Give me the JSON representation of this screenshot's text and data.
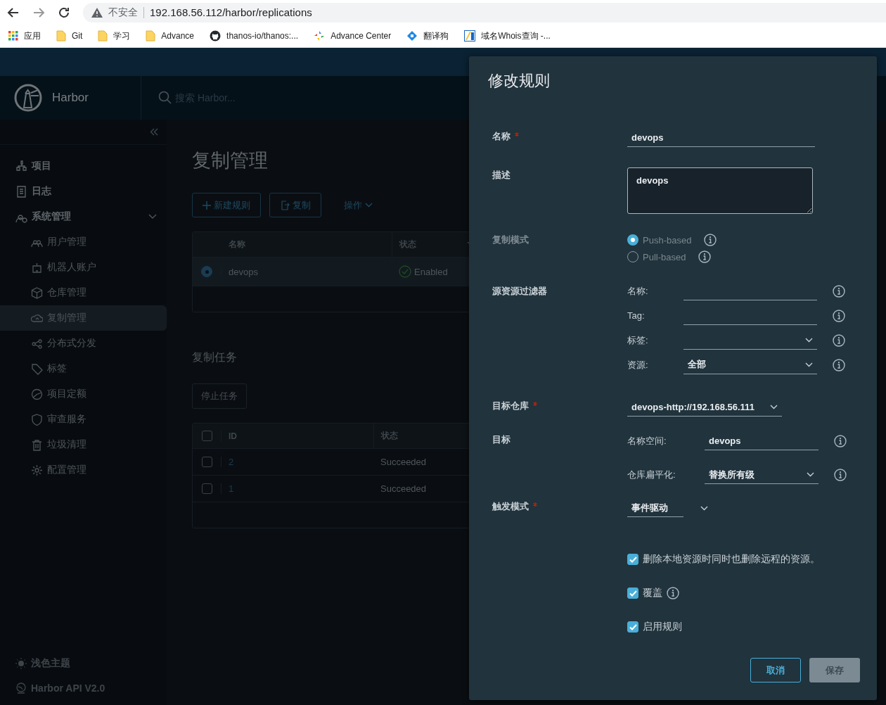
{
  "browser": {
    "security": "不安全",
    "url": "192.168.56.112/harbor/replications",
    "bookmarks": [
      {
        "label": "应用",
        "kind": "apps"
      },
      {
        "label": "Git",
        "kind": "folder"
      },
      {
        "label": "学习",
        "kind": "folder"
      },
      {
        "label": "Advance",
        "kind": "folder"
      },
      {
        "label": "thanos-io/thanos:...",
        "kind": "github"
      },
      {
        "label": "Advance Center",
        "kind": "pinwheel"
      },
      {
        "label": "翻译狗",
        "kind": "diamond"
      },
      {
        "label": "域名Whois查询 -...",
        "kind": "square"
      }
    ]
  },
  "header": {
    "brand": "Harbor",
    "search": {
      "placeholder": "搜索 Harbor..."
    }
  },
  "sidebar": {
    "items": [
      {
        "label": "项目",
        "selected": false
      },
      {
        "label": "日志",
        "selected": false
      },
      {
        "label": "系统管理",
        "selected": false,
        "expanded": true,
        "children": [
          {
            "label": "用户管理",
            "selected": false
          },
          {
            "label": "机器人账户",
            "selected": false
          },
          {
            "label": "仓库管理",
            "selected": false
          },
          {
            "label": "复制管理",
            "selected": true
          },
          {
            "label": "分布式分发",
            "selected": false
          },
          {
            "label": "标签",
            "selected": false
          },
          {
            "label": "项目定额",
            "selected": false
          },
          {
            "label": "审查服务",
            "selected": false
          },
          {
            "label": "垃圾清理",
            "selected": false
          },
          {
            "label": "配置管理",
            "selected": false
          }
        ]
      }
    ],
    "footer": [
      {
        "label": "浅色主题"
      },
      {
        "label": "Harbor API V2.0"
      }
    ]
  },
  "main": {
    "title": "复制管理",
    "toolbar": [
      {
        "label": "新建规则"
      },
      {
        "label": "复制"
      },
      {
        "label": "操作"
      }
    ],
    "rules_table": {
      "columns": [
        "名称",
        "状态"
      ],
      "rows": [
        {
          "selected": true,
          "name": "devops",
          "status": "Enabled"
        }
      ]
    },
    "tasks_title": "复制任务",
    "stop_button": {
      "label": "停止任务",
      "disabled": true
    },
    "tasks_table": {
      "select_all_checked": false,
      "columns": [
        "ID",
        "状态"
      ],
      "rows": [
        {
          "checked": false,
          "id": "2",
          "status": "Succeeded"
        },
        {
          "checked": false,
          "id": "1",
          "status": "Succeeded"
        }
      ]
    }
  },
  "dialog": {
    "title": "修改规则",
    "name": {
      "label": "名称",
      "required": true,
      "value": "devops"
    },
    "description": {
      "label": "描述",
      "value": "devops"
    },
    "mode": {
      "label": "复制模式",
      "disabled": true,
      "options": [
        {
          "label": "Push-based",
          "selected": true
        },
        {
          "label": "Pull-based",
          "selected": false
        }
      ]
    },
    "filters": {
      "label": "源资源过滤器",
      "rows": [
        {
          "label": "名称:",
          "kind": "text"
        },
        {
          "label": "Tag:",
          "kind": "text"
        },
        {
          "label": "标签:",
          "kind": "select"
        },
        {
          "label": "资源:",
          "kind": "select",
          "value": "全部"
        }
      ]
    },
    "target_registry": {
      "label": "目标仓库",
      "required": true,
      "value": "devops-http://192.168.56.111"
    },
    "target": {
      "label": "目标",
      "rows": [
        {
          "label": "名称空间:",
          "kind": "text",
          "value": "devops"
        },
        {
          "label": "仓库扁平化:",
          "kind": "select",
          "value": "替换所有级"
        }
      ]
    },
    "trigger": {
      "label": "触发模式",
      "required": true,
      "value": "事件驱动"
    },
    "options": [
      {
        "label": "删除本地资源时同时也删除远程的资源。",
        "checked": true,
        "info": false
      },
      {
        "label": "覆盖",
        "checked": true,
        "info": true
      },
      {
        "label": "启用规则",
        "checked": true,
        "info": false
      }
    ],
    "buttons": [
      {
        "label": "取消",
        "kind": "outline"
      },
      {
        "label": "保存",
        "kind": "solid"
      }
    ]
  }
}
